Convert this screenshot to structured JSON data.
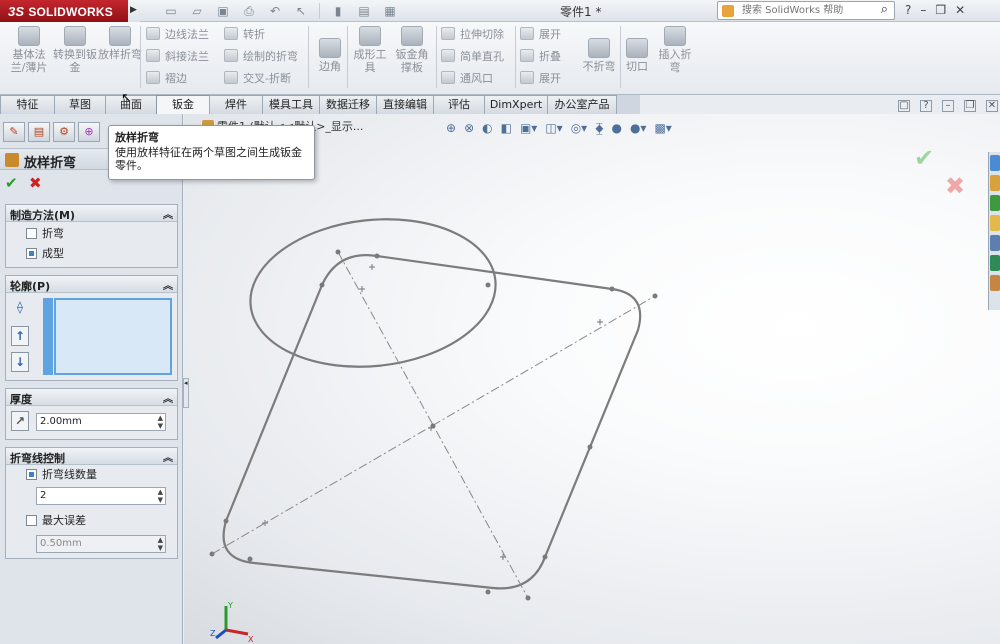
{
  "app": {
    "logo_prefix": "3S",
    "logo_text": "SOLIDWORKS",
    "document_title": "零件1 *",
    "search_placeholder": "搜索 SolidWorks 帮助"
  },
  "ribbon": {
    "big": [
      {
        "label": "基体法兰/薄片",
        "icon": "base-flange-icon"
      },
      {
        "label": "转换到钣金",
        "icon": "convert-sheet-metal-icon"
      },
      {
        "label": "放样折弯",
        "icon": "lofted-bend-icon"
      }
    ],
    "col2": [
      "边线法兰",
      "斜接法兰",
      "褶边"
    ],
    "col3": [
      "转折",
      "绘制的折弯",
      "交叉-折断"
    ],
    "corner": "边角",
    "forming_tool": "成形工具",
    "gusset": "钣金角撑板",
    "col4": [
      "拉伸切除",
      "简单直孔",
      "通风口"
    ],
    "col5": [
      "展开",
      "折叠",
      "展开"
    ],
    "no_bends": "不折弯",
    "rip": "切口",
    "insert_bends": "插入折弯"
  },
  "tabs": [
    "特征",
    "草图",
    "曲面",
    "钣金",
    "焊件",
    "模具工具",
    "数据迁移",
    "直接编辑",
    "评估",
    "DimXpert",
    "办公室产品"
  ],
  "active_tab": "钣金",
  "tooltip": {
    "title": "放样折弯",
    "body": "使用放样特征在两个草图之间生成钣金零件。"
  },
  "property_manager": {
    "title": "放样折弯",
    "manufacturing": {
      "header": "制造方法(M)",
      "options": [
        "折弯",
        "成型"
      ],
      "selected": "成型"
    },
    "profiles": {
      "header": "轮廓(P)"
    },
    "thickness": {
      "header": "厚度",
      "value": "2.00mm"
    },
    "bend_line": {
      "header": "折弯线控制",
      "count_label": "折弯线数量",
      "count_value": "2",
      "max_dev_label": "最大误差",
      "max_dev_value": "0.50mm"
    }
  },
  "breadcrumb": "零件1 (默认<<默认>_显示..."
}
